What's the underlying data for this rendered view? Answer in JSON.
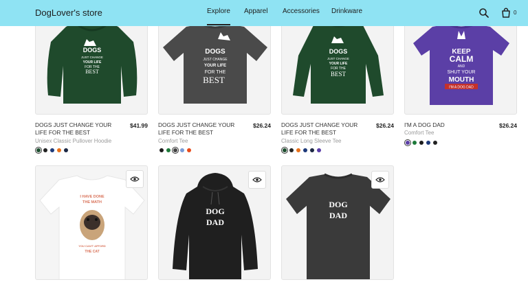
{
  "header": {
    "brand": "DogLover's store",
    "nav": [
      {
        "label": "Explore",
        "active": true
      },
      {
        "label": "Apparel",
        "active": false
      },
      {
        "label": "Accessories",
        "active": false
      },
      {
        "label": "Drinkware",
        "active": false
      }
    ],
    "cart_count": "0",
    "icons": [
      "search-icon",
      "shopping-bag-icon"
    ]
  },
  "products": [
    {
      "title": "DOGS JUST CHANGE YOUR LIFE FOR THE BEST",
      "price": "$41.99",
      "type": "Unisex Classic Pullover Hoodie",
      "swatches": [
        "#1e4f30",
        "#222222",
        "#1d3a7a",
        "#e8711b",
        "#1b2743"
      ],
      "selected_swatch": 0,
      "print_lines": [
        "DOGS",
        "JUST CHANGE",
        "YOUR LIFE",
        "FOR THE",
        "BEST"
      ]
    },
    {
      "title": "DOGS JUST CHANGE YOUR LIFE FOR THE BEST",
      "price": "$26.24",
      "type": "Comfort Tee",
      "swatches": [
        "#1c1c1c",
        "#1e7a3a",
        "#444444",
        "#7b9bd6",
        "#e84b1b"
      ],
      "selected_swatch": 2,
      "print_lines": [
        "DOGS",
        "JUST CHANGE",
        "YOUR LIFE",
        "FOR THE",
        "BEST"
      ]
    },
    {
      "title": "DOGS JUST CHANGE YOUR LIFE FOR THE BEST",
      "price": "$26.24",
      "type": "Classic Long Sleeve Tee",
      "swatches": [
        "#1e4f30",
        "#222222",
        "#e8711b",
        "#1d3a7a",
        "#1b2743",
        "#5a3ea8"
      ],
      "selected_swatch": 0,
      "print_lines": [
        "DOGS",
        "JUST CHANGE",
        "YOUR LIFE",
        "FOR THE",
        "BEST"
      ]
    },
    {
      "title": "I'M A DOG DAD",
      "price": "$26.24",
      "type": "Comfort Tee",
      "swatches": [
        "#5b3fa6",
        "#1e7a3a",
        "#1c1c1c",
        "#1d3a7a",
        "#222222"
      ],
      "selected_swatch": 0,
      "print_lines": [
        "KEEP",
        "CALM",
        "AND",
        "SHUT YOUR",
        "MOUTH",
        "I'M A DOG DAD"
      ]
    },
    {
      "print_lines": [
        "I HAVE DONE",
        "THE MATH",
        "YOU CAN'T AFFORD",
        "THE CAT"
      ]
    },
    {
      "print_lines": [
        "DOG",
        "DAD"
      ]
    },
    {
      "print_lines": [
        "DOG",
        "DAD"
      ]
    }
  ],
  "colors": {
    "header_bg": "#8fe3f3",
    "hoodie_green": "#1f4a2c",
    "tee_grey": "#4a4a4a",
    "purple": "#5b3fa6",
    "black": "#1f1f1f",
    "charcoal": "#3a3a3a",
    "mouth_red": "#c4302b"
  }
}
